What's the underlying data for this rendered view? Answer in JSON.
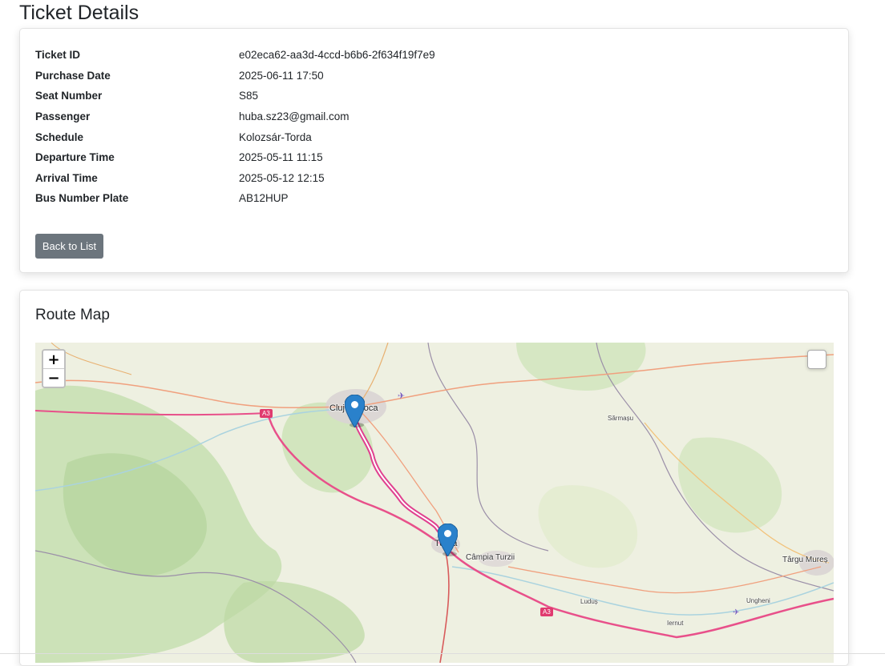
{
  "page": {
    "title": "Ticket Details"
  },
  "details": {
    "rows": [
      {
        "label": "Ticket ID",
        "value": "e02eca62-aa3d-4ccd-b6b6-2f634f19f7e9"
      },
      {
        "label": "Purchase Date",
        "value": "2025-06-11 17:50"
      },
      {
        "label": "Seat Number",
        "value": "S85"
      },
      {
        "label": "Passenger",
        "value": "huba.sz23@gmail.com"
      },
      {
        "label": "Schedule",
        "value": "Kolozsár-Torda"
      },
      {
        "label": "Departure Time",
        "value": "2025-05-11 11:15"
      },
      {
        "label": "Arrival Time",
        "value": "2025-05-12 12:15"
      },
      {
        "label": "Bus Number Plate",
        "value": "AB12HUP"
      }
    ],
    "back_button": "Back to List"
  },
  "map_section": {
    "title": "Route Map",
    "zoom_in": "+",
    "zoom_out": "−",
    "labels": {
      "cluj": "Cluj-Napoca",
      "turda": "Turda",
      "campia": "Câmpia Turzii",
      "targu": "Târgu Mureș",
      "sarmasu": "Sărmașu",
      "ludus": "Luduș",
      "iernut": "Iernut",
      "ungheni": "Ungheni",
      "a3_west": "A3",
      "a3_east": "A3"
    },
    "colors": {
      "route": "#e0408f",
      "motorway": "#e8508a",
      "marker": "#2a81cb"
    }
  }
}
